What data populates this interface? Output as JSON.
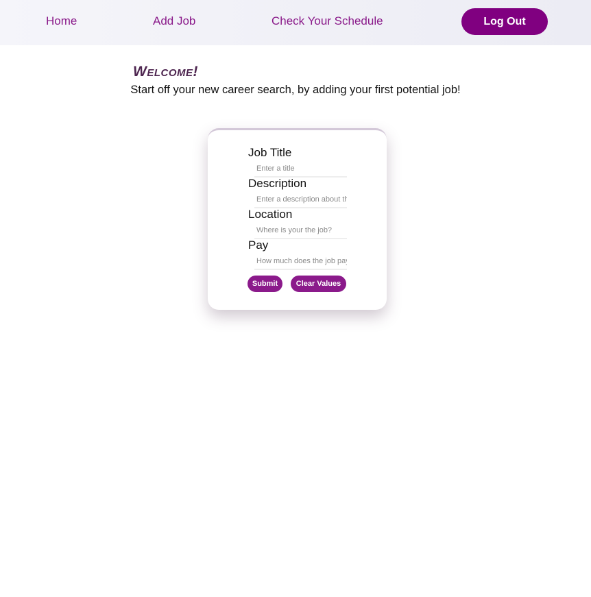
{
  "nav": {
    "home": "Home",
    "add_job": "Add Job",
    "schedule": "Check Your Schedule",
    "logout": "Log Out"
  },
  "welcome": {
    "heading": "Welcome!",
    "subtitle": "Start off your new career search, by adding your first potential job!"
  },
  "form": {
    "fields": [
      {
        "label": "Job Title",
        "placeholder": "Enter a title",
        "value": ""
      },
      {
        "label": "Description",
        "placeholder": "Enter a description about the job",
        "value": ""
      },
      {
        "label": "Location",
        "placeholder": "Where is your the job?",
        "value": ""
      },
      {
        "label": "Pay",
        "placeholder": "How much does the job pay?",
        "value": ""
      }
    ],
    "submit": "Submit",
    "clear": "Clear Values"
  },
  "colors": {
    "accent": "#800080",
    "heading": "#4e2650"
  }
}
